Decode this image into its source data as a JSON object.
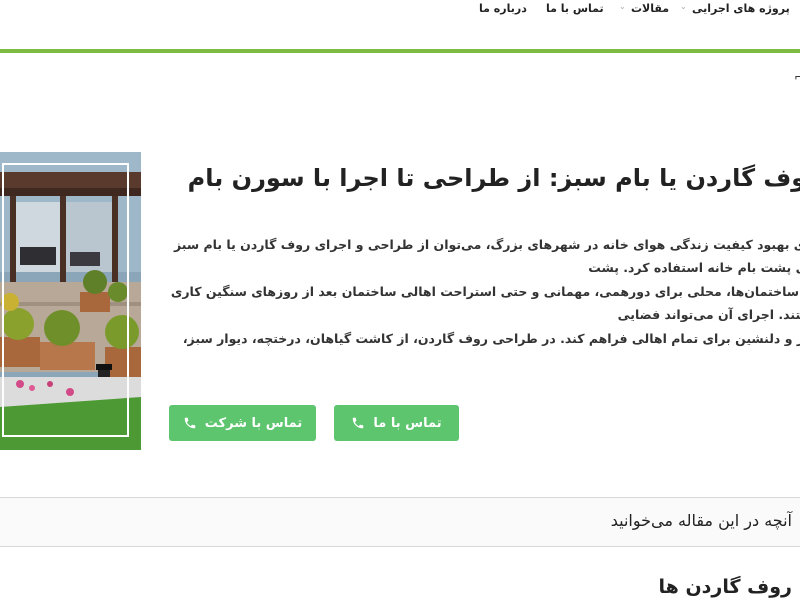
{
  "nav": {
    "items": [
      {
        "label": "پروژه های اجرایی",
        "has_dropdown": true
      },
      {
        "label": "مقالات",
        "has_dropdown": true
      },
      {
        "label": "تماس با ما",
        "has_dropdown": false
      },
      {
        "label": "درباره ما",
        "has_dropdown": false
      }
    ]
  },
  "colors": {
    "accent": "#7dbb42",
    "button": "#5cc56e"
  },
  "article": {
    "title": "روف گاردن یا بام سبز: از طراحی تا اجرا با سورن بام",
    "body": "برای بهبود کیفیت زندگی هوای خانه در شهرهای بزرگ، می‌توان از طراحی و اجرای روف گاردن یا بام سبز روی پشت بام خانه استفاده کرد. پشت\nبام ساختمان‌ها، محلی برای دورهمی، مهمانی و حتی استراحت اهالی ساختمان بعد از روزهای سنگین کاری هستند. اجرای آن می‌تواند فضایی\nسبز و دلنشین برای تمام اهالی فراهم کند. در طراحی روف گاردن، از کاشت گیاهان، درختچه، دیوار سبز، مسیرهای رفت و آمد، برکه و استخر\nکوچک آبی، آلاچیق مدرن شیشه‌ای برای دورهمی و... استفاده کرد. صفر تا صد طراحی و اجرای انواع روف گاردن توسط شرکت سورن\nبام انجام می‌شود."
  },
  "buttons": {
    "call_us": "تماس با ما",
    "call_company": "تماس با شرکت"
  },
  "toc": {
    "label": "آنچه در این مقاله می‌خوانید"
  },
  "section": {
    "heading": "روف گاردن ها"
  }
}
